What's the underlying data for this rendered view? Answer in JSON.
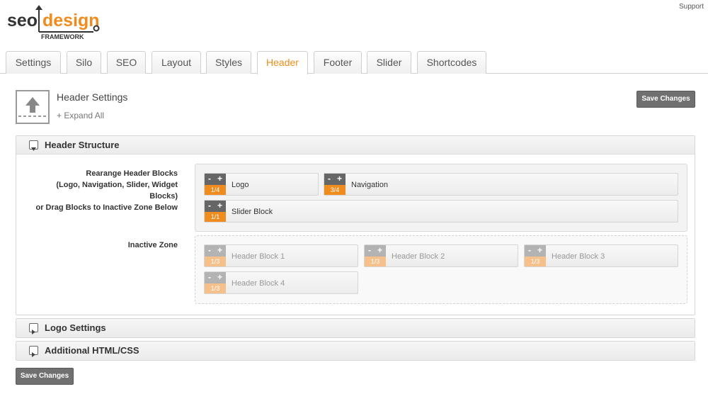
{
  "brand": {
    "text_seo": "seo",
    "text_design": "design",
    "text_framework": "FRAMEWORK",
    "accent": "#f08c1e"
  },
  "support_link": "Support",
  "tabs": [
    {
      "label": "Settings",
      "active": false
    },
    {
      "label": "Silo",
      "active": false
    },
    {
      "label": "SEO",
      "active": false
    },
    {
      "label": "Layout",
      "active": false
    },
    {
      "label": "Styles",
      "active": false
    },
    {
      "label": "Header",
      "active": true
    },
    {
      "label": "Footer",
      "active": false
    },
    {
      "label": "Slider",
      "active": false
    },
    {
      "label": "Shortcodes",
      "active": false
    }
  ],
  "page": {
    "title": "Header Settings",
    "expand_all": "+ Expand All",
    "save_label": "Save Changes"
  },
  "sections": {
    "structure": {
      "title": "Header Structure",
      "rearrange_label": [
        "Rearange Header Blocks",
        "(Logo, Navigation, Slider, Widget",
        "Blocks)",
        "or Drag Blocks to Inactive Zone Below"
      ],
      "inactive_label": "Inactive Zone",
      "active_blocks": [
        {
          "name": "Logo",
          "size": "1/4"
        },
        {
          "name": "Navigation",
          "size": "3/4"
        },
        {
          "name": "Slider Block",
          "size": "1/1"
        }
      ],
      "inactive_blocks": [
        {
          "name": "Header Block 1",
          "size": "1/3"
        },
        {
          "name": "Header Block 2",
          "size": "1/3"
        },
        {
          "name": "Header Block 3",
          "size": "1/3"
        },
        {
          "name": "Header Block 4",
          "size": "1/3"
        }
      ],
      "minus": "-",
      "plus": "+"
    },
    "logo": {
      "title": "Logo Settings"
    },
    "html_css": {
      "title": "Additional HTML/CSS"
    }
  }
}
